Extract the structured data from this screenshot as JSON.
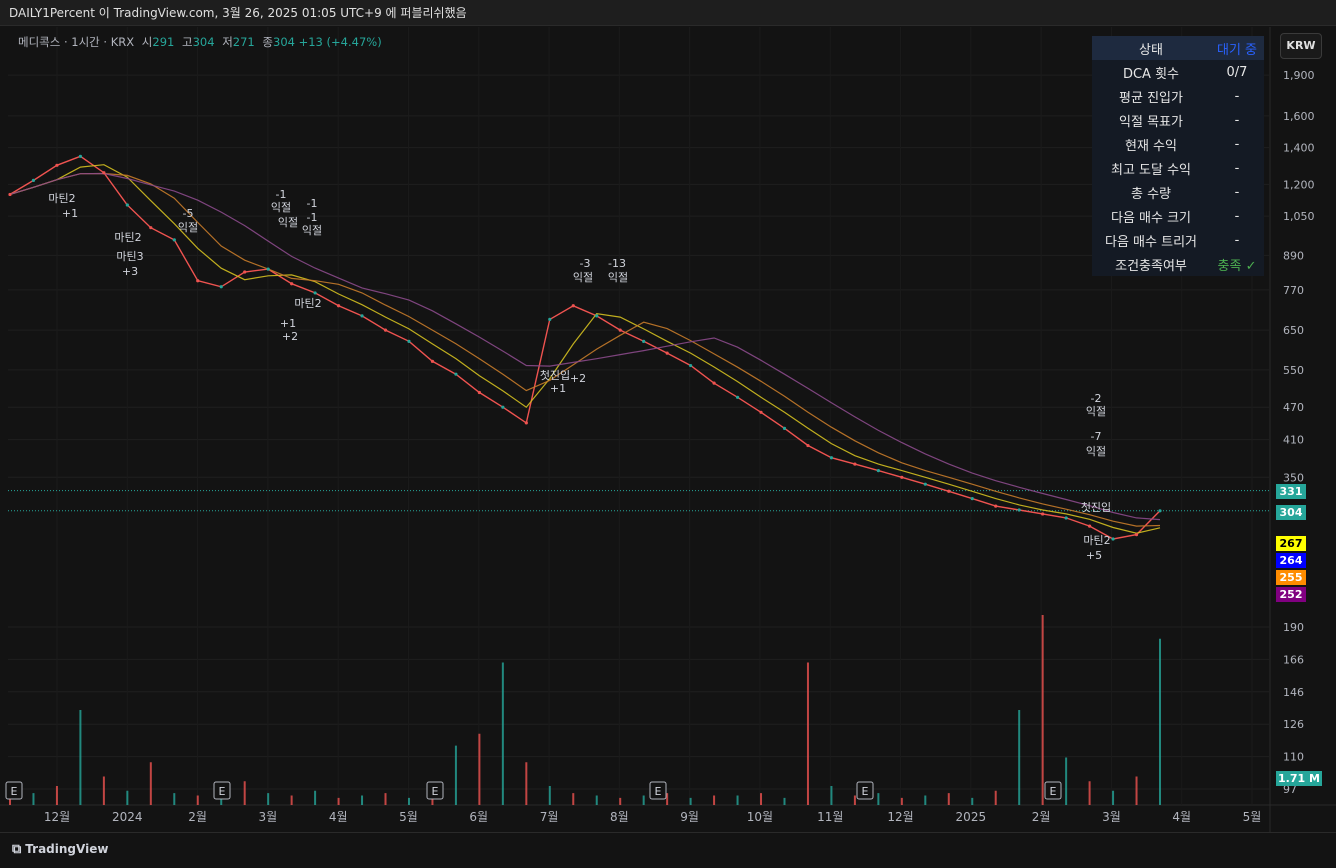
{
  "header": {
    "text": "DAILY1Percent 이 TradingView.com, 3월 26, 2025 01:05 UTC+9 에 퍼블리쉬했음"
  },
  "legend": {
    "symbol": "메디콕스 · 1시간 · KRX",
    "open_label": "시",
    "open": "291",
    "high_label": "고",
    "high": "304",
    "low_label": "저",
    "low": "271",
    "close_label": "종",
    "close": "304",
    "change": "+13 (+4.47%)"
  },
  "currency": "KRW",
  "status_table": {
    "rows": [
      {
        "key": "상태",
        "value": "대기 중"
      },
      {
        "key": "DCA 횟수",
        "value": "0/7"
      },
      {
        "key": "평균 진입가",
        "value": "-"
      },
      {
        "key": "익절 목표가",
        "value": "-"
      },
      {
        "key": "현재 수익",
        "value": "-"
      },
      {
        "key": "최고 도달 수익",
        "value": "-"
      },
      {
        "key": "총 수량",
        "value": "-"
      },
      {
        "key": "다음 매수 크기",
        "value": "-"
      },
      {
        "key": "다음 매수 트리거",
        "value": "-"
      },
      {
        "key": "조건충족여부",
        "value": "충족 ✓"
      }
    ]
  },
  "price_tags": [
    {
      "value": "331",
      "bg": "#26a69a",
      "fg": "#ffffff"
    },
    {
      "value": "304",
      "bg": "#26a69a",
      "fg": "#ffffff"
    },
    {
      "value": "267",
      "bg": "#ffff00",
      "fg": "#000000"
    },
    {
      "value": "264",
      "bg": "#0000ff",
      "fg": "#ffffff"
    },
    {
      "value": "255",
      "bg": "#ff8c00",
      "fg": "#ffffff"
    },
    {
      "value": "252",
      "bg": "#800080",
      "fg": "#ffffff"
    }
  ],
  "volume_tag": "1.71 M",
  "brand": "TradingView",
  "chart_data": {
    "type": "line",
    "y_scale": "log",
    "y_ticks": [
      "1,900",
      "1,600",
      "1,400",
      "1,200",
      "1,050",
      "890",
      "770",
      "650",
      "550",
      "470",
      "410",
      "350",
      "190",
      "166",
      "146",
      "126",
      "110",
      "97"
    ],
    "x_ticks": [
      "12월",
      "2024",
      "2월",
      "3월",
      "4월",
      "5월",
      "6월",
      "7월",
      "8월",
      "9월",
      "10월",
      "11월",
      "12월",
      "2025",
      "2월",
      "3월",
      "4월",
      "5월"
    ],
    "series": [
      {
        "values": [
          1150,
          1220,
          1300,
          1350,
          1260,
          1100,
          1000,
          950,
          800,
          780,
          830,
          840,
          790,
          760,
          720,
          690,
          650,
          620,
          570,
          540,
          500,
          470,
          440,
          680,
          720,
          690,
          650,
          620,
          590,
          560,
          520,
          490,
          460,
          430,
          400,
          380,
          370,
          360,
          350,
          340,
          330,
          320,
          310,
          305,
          300,
          295,
          285,
          270,
          275,
          304
        ]
      }
    ],
    "volume": {
      "values": [
        3,
        5,
        8,
        40,
        12,
        6,
        18,
        5,
        4,
        6,
        10,
        5,
        4,
        6,
        3,
        4,
        5,
        3,
        6,
        25,
        30,
        60,
        18,
        8,
        5,
        4,
        3,
        4,
        5,
        3,
        4,
        4,
        5,
        3,
        60,
        8,
        4,
        5,
        3,
        4,
        5,
        3,
        6,
        40,
        80,
        20,
        10,
        6,
        12,
        70
      ]
    },
    "horizontal_lines": [
      331,
      304
    ],
    "event_label": "E",
    "annotations": [
      "마틴2",
      "+1",
      "마틴2",
      "마틴3",
      "+3",
      "-5",
      "익절",
      "-1",
      "익절",
      "익절",
      "-1",
      "-1",
      "익절",
      "+1",
      "+2",
      "마틴2",
      "첫진입",
      "+1",
      "+2",
      "-3",
      "익절",
      "-13",
      "익절",
      "-2",
      "익절",
      "-7",
      "익절",
      "첫진입",
      "마틴2",
      "+5"
    ]
  }
}
